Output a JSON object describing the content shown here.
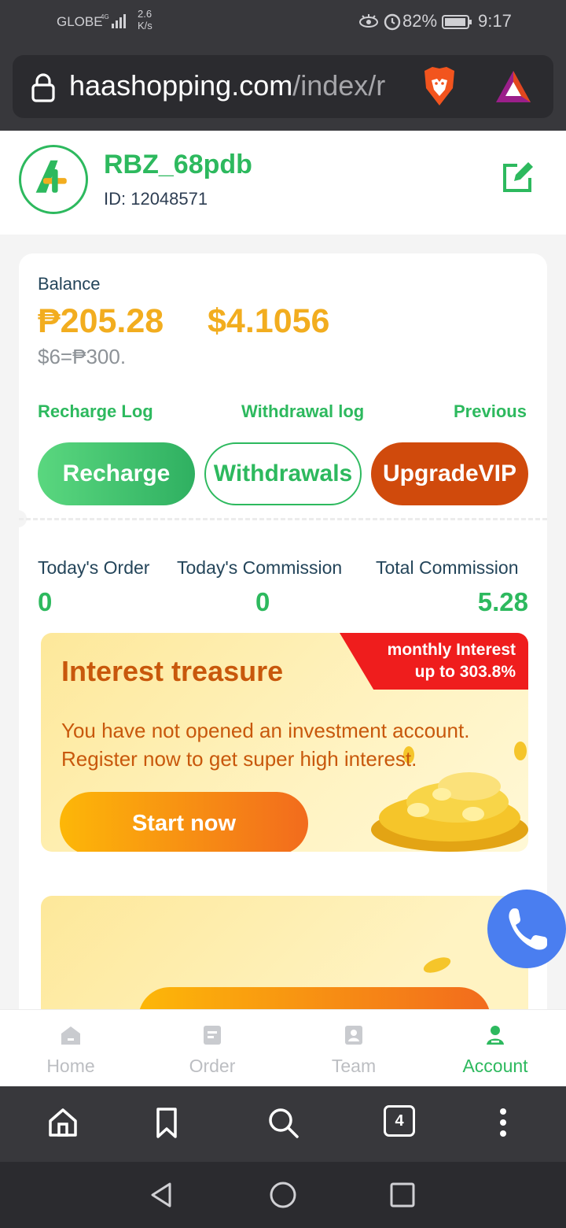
{
  "status_bar": {
    "carrier": "GLOBE",
    "network_speed": "2.6",
    "network_speed_unit": "K/s",
    "battery_percent": "82%",
    "time": "9:17"
  },
  "browser": {
    "url_host": "haashopping.com",
    "url_path": "/index/r",
    "tab_count": "4"
  },
  "profile": {
    "username": "RBZ_68pdb",
    "user_id": "ID: 12048571"
  },
  "balance": {
    "label": "Balance",
    "peso": "₱205.28",
    "usd": "$4.1056",
    "rate": "$6=₱300."
  },
  "links": {
    "recharge_log": "Recharge Log",
    "withdrawal_log": "Withdrawal log",
    "previous": "Previous"
  },
  "actions": {
    "recharge": "Recharge",
    "withdrawals": "Withdrawals",
    "upgrade_vip": "UpgradeVIP"
  },
  "stats": [
    {
      "label": "Today's Order",
      "value": "0"
    },
    {
      "label": "Today's Commission",
      "value": "0"
    },
    {
      "label": "Total Commission",
      "value": "5.28"
    }
  ],
  "promo": {
    "badge_line1": "monthly Interest",
    "badge_line2": "up to 303.8%",
    "title": "Interest treasure",
    "text": "You have not opened an investment account. Register now to get super high interest.",
    "button": "Start now"
  },
  "bottom_nav": [
    {
      "label": "Home",
      "icon": "home-icon",
      "active": false
    },
    {
      "label": "Order",
      "icon": "order-icon",
      "active": false
    },
    {
      "label": "Team",
      "icon": "team-icon",
      "active": false
    },
    {
      "label": "Account",
      "icon": "account-icon",
      "active": true
    }
  ],
  "colors": {
    "brand_green": "#2db95e",
    "balance_gold": "#f2ad1f",
    "vip_orange": "#d04a0c",
    "promo_text": "#c8580c",
    "badge_red": "#ef1d1d",
    "fab_blue": "#4a7ef0"
  }
}
